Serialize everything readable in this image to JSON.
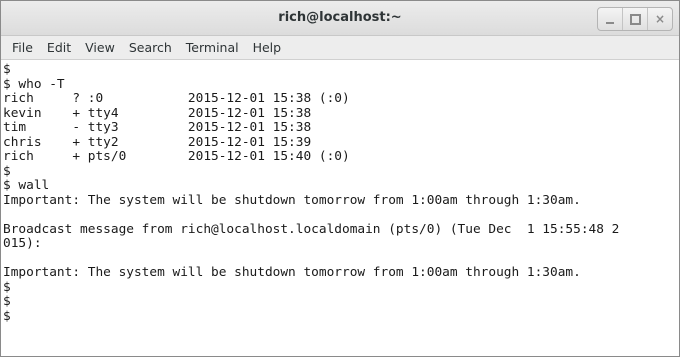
{
  "window": {
    "title": "rich@localhost:~",
    "controls": {
      "minimize": "minimize",
      "maximize": "maximize",
      "close": "×"
    }
  },
  "menubar": {
    "items": [
      {
        "label": "File"
      },
      {
        "label": "Edit"
      },
      {
        "label": "View"
      },
      {
        "label": "Search"
      },
      {
        "label": "Terminal"
      },
      {
        "label": "Help"
      }
    ]
  },
  "terminal": {
    "lines": [
      "$",
      "$ who -T",
      "rich     ? :0           2015-12-01 15:38 (:0)",
      "kevin    + tty4         2015-12-01 15:38",
      "tim      - tty3         2015-12-01 15:38",
      "chris    + tty2         2015-12-01 15:39",
      "rich     + pts/0        2015-12-01 15:40 (:0)",
      "$",
      "$ wall",
      "Important: The system will be shutdown tomorrow from 1:00am through 1:30am.",
      "",
      "Broadcast message from rich@localhost.localdomain (pts/0) (Tue Dec  1 15:55:48 2",
      "015):",
      "",
      "Important: The system will be shutdown tomorrow from 1:00am through 1:30am.",
      "$",
      "$",
      "$"
    ]
  }
}
